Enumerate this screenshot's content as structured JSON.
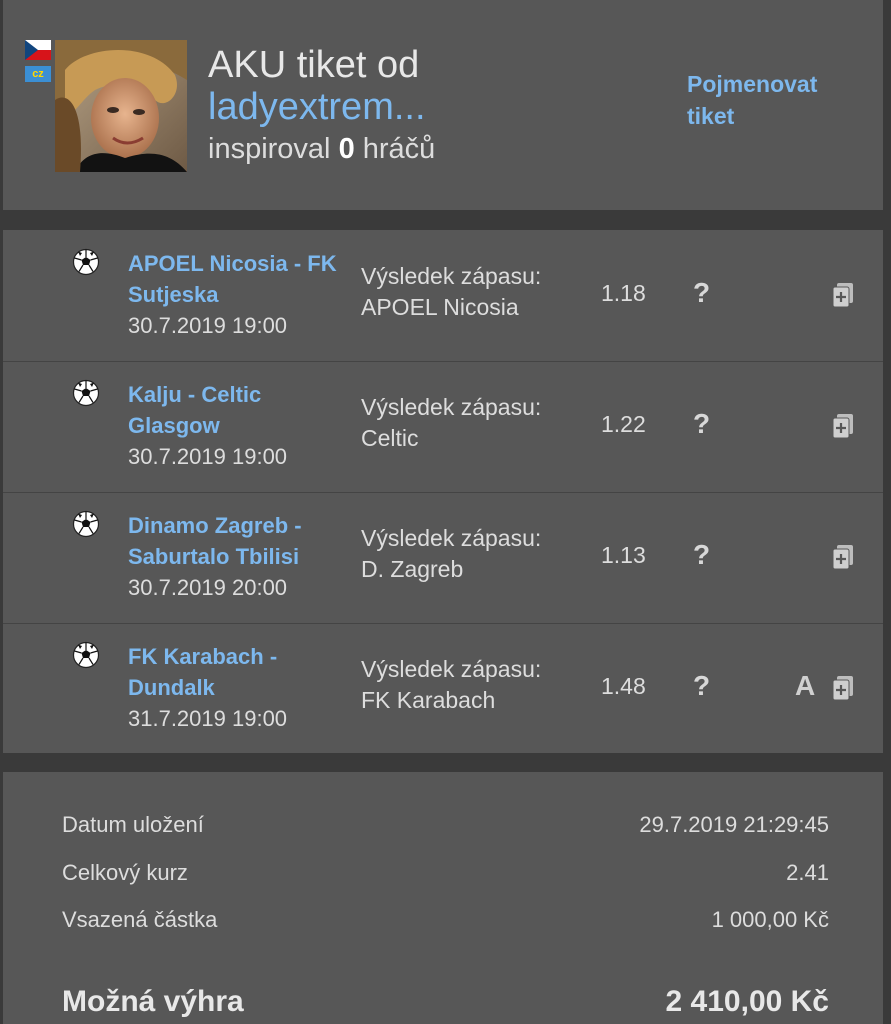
{
  "header": {
    "title_prefix": "AKU tiket od",
    "username": "ladyextrem...",
    "inspired_prefix": "inspiroval",
    "inspired_count": "0",
    "inspired_suffix": "hráčů",
    "rename_link": "Pojmenovat tiket",
    "country_badge": "cz"
  },
  "bets": [
    {
      "teams": "APOEL Nicosia - FK Sutjeska",
      "datetime": "30.7.2019 19:00",
      "market_label": "Výsledek zápasu:",
      "selection": "APOEL Nicosia",
      "odds": "1.18",
      "status": "?",
      "flag": ""
    },
    {
      "teams": "Kalju - Celtic Glasgow",
      "datetime": "30.7.2019 19:00",
      "market_label": "Výsledek zápasu:",
      "selection": "Celtic",
      "odds": "1.22",
      "status": "?",
      "flag": ""
    },
    {
      "teams": "Dinamo Zagreb - Saburtalo Tbilisi",
      "datetime": "30.7.2019 20:00",
      "market_label": "Výsledek zápasu:",
      "selection": "D. Zagreb",
      "odds": "1.13",
      "status": "?",
      "flag": ""
    },
    {
      "teams": "FK Karabach - Dundalk",
      "datetime": "31.7.2019 19:00",
      "market_label": "Výsledek zápasu:",
      "selection": "FK Karabach",
      "odds": "1.48",
      "status": "?",
      "flag": "A"
    }
  ],
  "summary": {
    "saved_label": "Datum uložení",
    "saved_value": "29.7.2019 21:29:45",
    "total_odds_label": "Celkový kurz",
    "total_odds_value": "2.41",
    "stake_label": "Vsazená částka",
    "stake_value": "1 000,00 Kč",
    "win_label": "Možná výhra",
    "win_value": "2 410,00 Kč"
  },
  "colors": {
    "background": "#3a3a3a",
    "panel": "#575757",
    "link": "#7db8ee",
    "text": "#dddddd"
  },
  "icons": [
    "czech-flag-icon",
    "soccer-ball-icon",
    "question-icon",
    "add-to-ticket-icon"
  ]
}
